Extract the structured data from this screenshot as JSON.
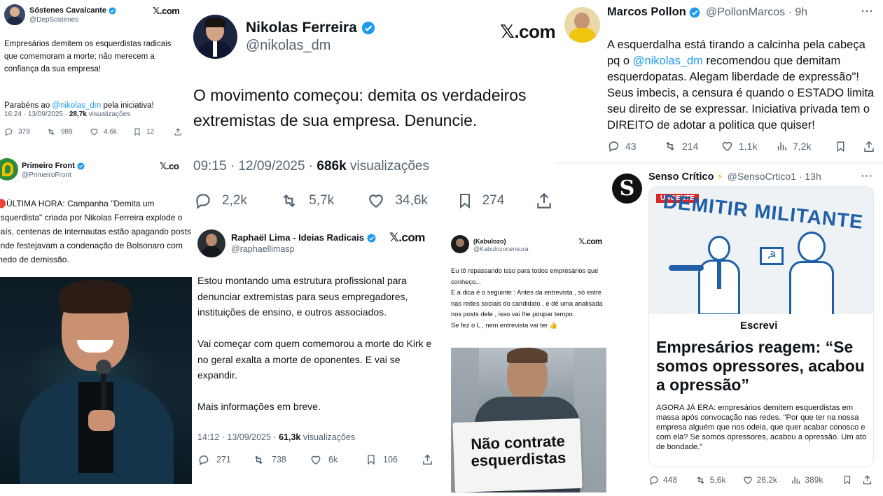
{
  "p1": {
    "name": "Sóstenes Cavalcante",
    "handle": "@DepSostenes",
    "x_logo": "𝕏.com",
    "text_1": "Empresários demitem os esquerdistas radicais que comemoram a morte; não merecem a confiança da sua empresa!",
    "text_2_a": "Parabéns ao ",
    "text_2_mention": "@nikolas_dm",
    "text_2_b": " pela iniciativa!",
    "meta_time": "16:24 · 13/09/2025 · ",
    "meta_views": "28,7k",
    "meta_views_label": " visualizações",
    "replies": "379",
    "retweets": "989",
    "likes": "4,6k",
    "bookmarks": "12"
  },
  "p2": {
    "name": "Nikolas Ferreira",
    "handle": "@nikolas_dm",
    "x_logo": "𝕏.com",
    "text": "O movimento começou: demita os verdadeiros extremistas de sua empresa. Denuncie.",
    "meta_time": "09:15 · 12/09/2025 · ",
    "meta_views": "686k",
    "meta_views_label": " visualizações",
    "replies": "2,2k",
    "retweets": "5,7k",
    "likes": "34,6k",
    "bookmarks": "274"
  },
  "p3": {
    "name": "Marcos Pollon",
    "handle": "@PollonMarcos · 9h",
    "more": "···",
    "text_a": "A esquerdalha está tirando a calcinha pela cabeça pq o ",
    "text_mention": "@nikolas_dm",
    "text_b": " recomendou que demitam esquerdopatas. Alegam liberdade de expressão\"! Seus imbecis, a censura é quando o ESTADO limita seu direito de se expressar. Iniciativa privada tem o DIREITO de adotar a politica que quiser!",
    "replies": "43",
    "retweets": "214",
    "likes": "1,1k",
    "views": "7,2k"
  },
  "p4": {
    "name": "Primeiro Front",
    "handle": "@PrimeiroFront",
    "x_logo": "𝕏.co",
    "text": "🔴ÚLTIMA HORA: Campanha \"Demita um esquerdista\" criada por Nikolas Ferreira explode o país, centenas de internautas estão apagando posts onde festejavam a condenação de Bolsonaro com medo de demissão."
  },
  "p5": {
    "name": "Raphaël Lima - Ideias Radicais",
    "handle": "@raphaellimasp",
    "x_logo": "𝕏.com",
    "text": "Estou montando uma estrutura profissional para denunciar extremistas para seus empregadores, instituições de ensino, e outros associados.\n\nVai começar com quem comemorou a morte do Kirk e no geral exalta a morte de oponentes. E vai se expandir.\n\nMais informações em breve.",
    "meta_time": "14:12 · 13/09/2025 · ",
    "meta_views": "61,3k",
    "meta_views_label": " visualizações",
    "replies": "271",
    "retweets": "738",
    "likes": "6k",
    "bookmarks": "106"
  },
  "p6": {
    "name": "(Kabulozo)",
    "handle": "@Kabulozocensura",
    "x_logo": "𝕏.com",
    "text": "Eu tô repassando isso para todos empresários que conheço...\nE a dica é o seguinte : Antes da entrevista , só entre nas redes sociais do candidato , e dê uma analisada nos posts dele , isso vai lhe poupar tempo.\nSe fez o L , nem entrevista vai ter 👍",
    "sign_text": "Não contrate esquerdistas"
  },
  "p7": {
    "name": "Senso Crítico",
    "bolt": "⚡",
    "handle": "@SensoCrtico1 · 13h",
    "more": "···",
    "badge": "URGENTE",
    "banner": "DEMITIR MILITANTE",
    "brand": "Escrevi",
    "headline": "Empresários reagem: “Se somos opressores, acabou a opressão”",
    "lead": "AGORA JÁ ERA: empresários demitem esquerdistas em massa após convocação nas redes. \"Por que ter na nossa empresa alguém que nos odeia, que quer acabar conosco e com ela? Se somos opressores, acabou a opressão. Um ato de bondade.\"",
    "replies": "448",
    "retweets": "5,6k",
    "likes": "26,2k",
    "views": "389k"
  },
  "colors": {
    "verified": "#1d9bf0",
    "mention": "#1d9bf0",
    "muted": "#536471",
    "urgent_red": "#d62828",
    "banner_blue": "#1f5fa8",
    "primeiro_front_green": "#2e8b3a"
  }
}
